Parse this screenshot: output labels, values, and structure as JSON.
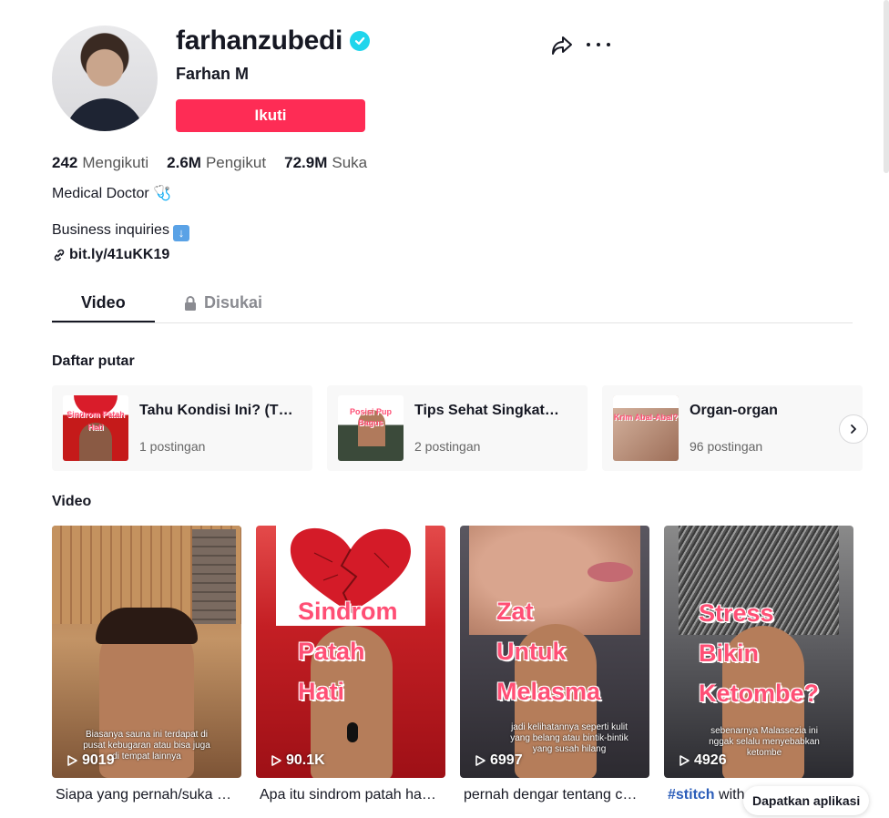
{
  "profile": {
    "username": "farhanzubedi",
    "nickname": "Farhan M",
    "follow_label": "Ikuti",
    "stats": [
      {
        "value": "242",
        "label": "Mengikuti"
      },
      {
        "value": "2.6M",
        "label": "Pengikut"
      },
      {
        "value": "72.9M",
        "label": "Suka"
      }
    ],
    "bio_line1": "Medical Doctor 🩺",
    "bio_line2": "Business inquiries",
    "link": "bit.ly/41uKK19"
  },
  "tabs": {
    "video": "Video",
    "liked": "Disukai"
  },
  "playlists": {
    "title": "Daftar putar",
    "items": [
      {
        "title": "Tahu Kondisi Ini? (TKI)",
        "count": "1 postingan",
        "thumb_text": "Sindrom Patah Hati"
      },
      {
        "title": "Tips Sehat Singkat…",
        "count": "2 postingan",
        "thumb_text": "Posisi Pup Bagus"
      },
      {
        "title": "Organ-organ",
        "count": "96 postingan",
        "thumb_text": "Krim Abal-Abal?"
      }
    ]
  },
  "videos": {
    "title": "Video",
    "items": [
      {
        "views": "9019",
        "desc": "Siapa yang pernah/suka …",
        "caption": "Biasanya sauna ini terdapat di pusat kebugaran atau bisa juga di tempat lainnya",
        "overlay": [
          "",
          "",
          ""
        ]
      },
      {
        "views": "90.1K",
        "desc": "Apa itu sindrom patah ha…",
        "caption": "",
        "overlay": [
          "Sindrom",
          "Patah",
          "Hati"
        ]
      },
      {
        "views": "6997",
        "desc": "pernah dengar tentang c…",
        "caption": "jadi kelihatannya seperti kulit yang belang atau bintik-bintik yang susah hilang",
        "overlay": [
          "Zat",
          "Untuk",
          "Melasma"
        ]
      },
      {
        "views": "4926",
        "desc_hashtag": "#stitch",
        "desc": " with",
        "caption": "sebenarnya Malassezia ini nggak selalu menyebabkan ketombe",
        "overlay": [
          "Stress",
          "Bikin",
          "Ketombe?"
        ]
      }
    ]
  },
  "get_app": "Dapatkan aplikasi",
  "colors": {
    "accent": "#fe2c55",
    "verified": "#20d5ec",
    "hashtag": "#2b5db9"
  }
}
